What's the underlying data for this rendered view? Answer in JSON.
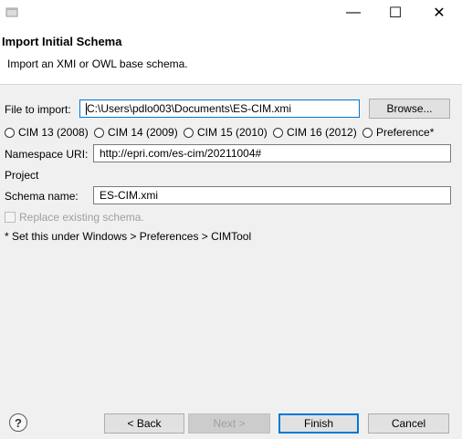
{
  "window": {
    "minimize_glyph": "—",
    "maximize_glyph": "☐",
    "close_glyph": "✕"
  },
  "header": {
    "title": "Import Initial Schema",
    "description": "Import an XMI or OWL base schema."
  },
  "form": {
    "file_label": "File to import:",
    "file_value": "C:\\Users\\pdlo003\\Documents\\ES-CIM.xmi",
    "browse_label": "Browse...",
    "radios": [
      {
        "label": "CIM 13 (2008)",
        "selected": false
      },
      {
        "label": "CIM 14 (2009)",
        "selected": false
      },
      {
        "label": "CIM 15 (2010)",
        "selected": false
      },
      {
        "label": "CIM 16 (2012)",
        "selected": false
      },
      {
        "label": "Preference*",
        "selected": false
      }
    ],
    "namespace_label": "Namespace URI:",
    "namespace_value": "http://epri.com/es-cim/20211004#",
    "project_label": "Project",
    "schema_label": "Schema name:",
    "schema_value": "ES-CIM.xmi",
    "replace_label": "Replace existing schema.",
    "note": "* Set this under Windows > Preferences > CIMTool"
  },
  "footer": {
    "help_glyph": "?",
    "back_label": "< Back",
    "next_label": "Next >",
    "finish_label": "Finish",
    "cancel_label": "Cancel"
  },
  "colors": {
    "accent": "#0078d7",
    "dialog_bg": "#f0f0f0",
    "header_bg": "#ffffff"
  },
  "icons": {
    "app": "eclipse-window-icon",
    "help": "help-icon"
  }
}
